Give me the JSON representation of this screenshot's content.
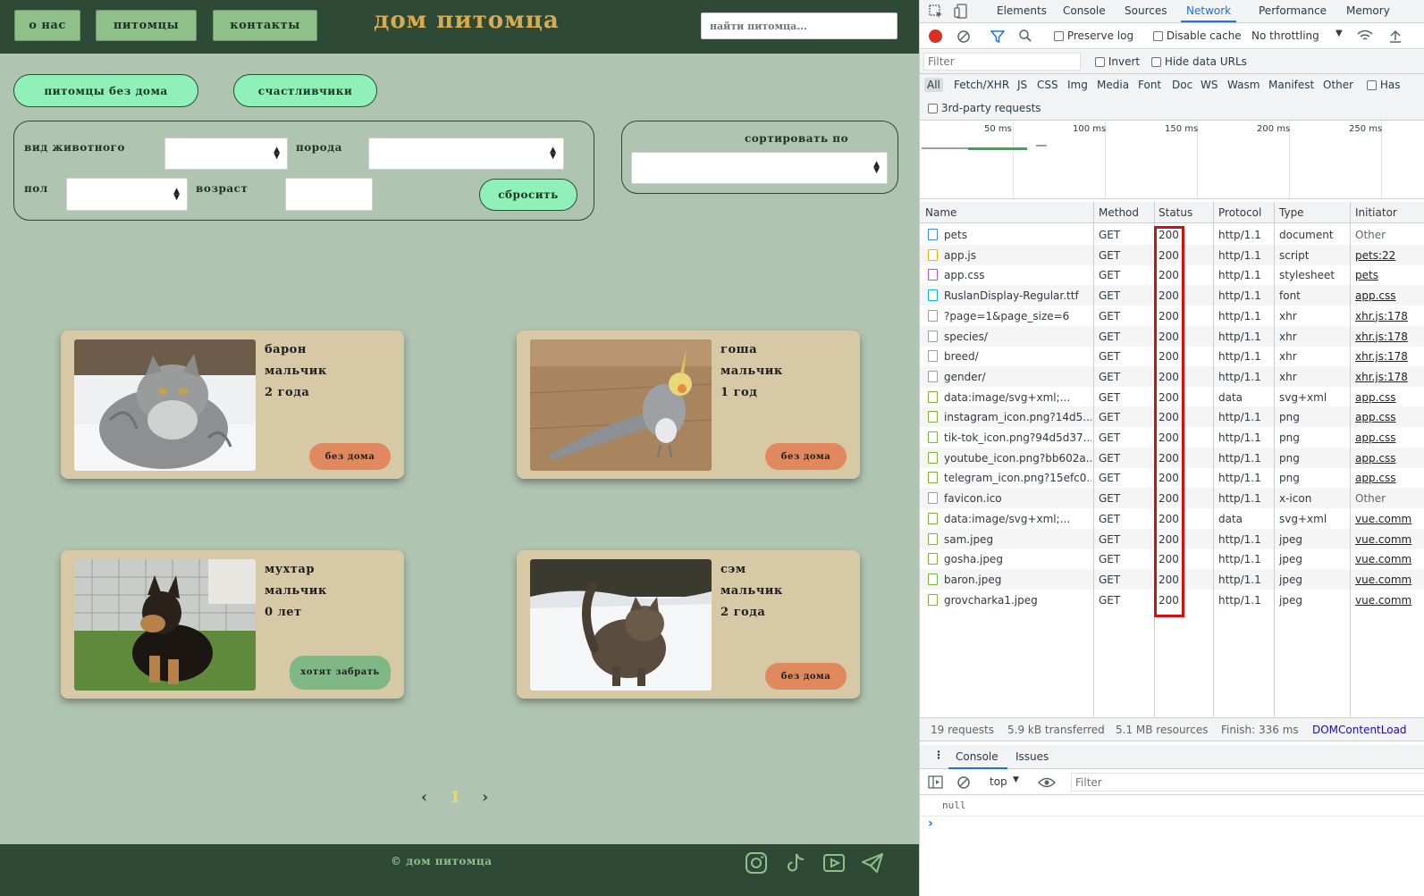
{
  "site": {
    "nav": {
      "about": "о нас",
      "pets": "питомцы",
      "contacts": "контакты"
    },
    "logo": "дом питомца",
    "search_placeholder": "найти питомца...",
    "tabs": {
      "homeless": "питомцы без дома",
      "lucky": "счастливчики"
    },
    "filters": {
      "species_label": "вид животного",
      "breed_label": "порода",
      "gender_label": "пол",
      "age_label": "возраст",
      "reset_label": "сбросить",
      "sort_label": "сортировать по"
    },
    "cards": [
      {
        "name": "барон",
        "gender": "мальчик",
        "age": "2 года",
        "status": "без дома",
        "status_kind": "homeless",
        "photo": "gray-cat"
      },
      {
        "name": "гоша",
        "gender": "мальчик",
        "age": "1 год",
        "status": "без дома",
        "status_kind": "homeless",
        "photo": "cockatiel"
      },
      {
        "name": "мухтар",
        "gender": "мальчик",
        "age": "0 лет",
        "status": "хотят забрать",
        "status_kind": "pending",
        "photo": "shepherd-puppy"
      },
      {
        "name": "сэм",
        "gender": "мальчик",
        "age": "2 года",
        "status": "без дома",
        "status_kind": "homeless",
        "photo": "tabby-cat-snow"
      }
    ],
    "pager": {
      "prev": "‹",
      "current": "1",
      "next": "›"
    },
    "footer": {
      "copyright": "© дом питомца"
    },
    "social_icons": [
      "instagram-icon",
      "tiktok-icon",
      "youtube-icon",
      "telegram-icon"
    ],
    "colors": {
      "header": "#2e4a37",
      "page_bg": "#b0c4b2",
      "logo": "#d7ab4f",
      "pill": "#8ff1b8",
      "card": "#d7c9a6",
      "homeless": "#e0895e",
      "pending": "#7fb885"
    }
  },
  "devtools": {
    "tabs": [
      "Elements",
      "Console",
      "Sources",
      "Network",
      "Performance",
      "Memory"
    ],
    "active_tab": "Network",
    "toolbar": {
      "preserve_log": "Preserve log",
      "disable_cache": "Disable cache",
      "throttling": "No throttling"
    },
    "filter_placeholder": "Filter",
    "invert": "Invert",
    "hide_data_urls": "Hide data URLs",
    "type_filters": [
      "All",
      "Fetch/XHR",
      "JS",
      "CSS",
      "Img",
      "Media",
      "Font",
      "Doc",
      "WS",
      "Wasm",
      "Manifest",
      "Other"
    ],
    "has_label": "Has",
    "third_party": "3rd-party requests",
    "timeline_ticks": [
      "50 ms",
      "100 ms",
      "150 ms",
      "200 ms",
      "250 ms"
    ],
    "columns": [
      "Name",
      "Method",
      "Status",
      "Protocol",
      "Type",
      "Initiator"
    ],
    "requests": [
      {
        "name": "pets",
        "method": "GET",
        "status": "200",
        "protocol": "http/1.1",
        "type": "document",
        "initiator": "Other",
        "icon": "document-icon"
      },
      {
        "name": "app.js",
        "method": "GET",
        "status": "200",
        "protocol": "http/1.1",
        "type": "script",
        "initiator": "pets:22",
        "icon": "script-icon"
      },
      {
        "name": "app.css",
        "method": "GET",
        "status": "200",
        "protocol": "http/1.1",
        "type": "stylesheet",
        "initiator": "pets",
        "icon": "stylesheet-icon"
      },
      {
        "name": "RuslanDisplay-Regular.ttf",
        "method": "GET",
        "status": "200",
        "protocol": "http/1.1",
        "type": "font",
        "initiator": "app.css",
        "icon": "font-icon"
      },
      {
        "name": "?page=1&page_size=6",
        "method": "GET",
        "status": "200",
        "protocol": "http/1.1",
        "type": "xhr",
        "initiator": "xhr.js:178",
        "icon": "xhr-icon"
      },
      {
        "name": "species/",
        "method": "GET",
        "status": "200",
        "protocol": "http/1.1",
        "type": "xhr",
        "initiator": "xhr.js:178",
        "icon": "xhr-icon"
      },
      {
        "name": "breed/",
        "method": "GET",
        "status": "200",
        "protocol": "http/1.1",
        "type": "xhr",
        "initiator": "xhr.js:178",
        "icon": "xhr-icon"
      },
      {
        "name": "gender/",
        "method": "GET",
        "status": "200",
        "protocol": "http/1.1",
        "type": "xhr",
        "initiator": "xhr.js:178",
        "icon": "xhr-icon"
      },
      {
        "name": "data:image/svg+xml;...",
        "method": "GET",
        "status": "200",
        "protocol": "data",
        "type": "svg+xml",
        "initiator": "app.css",
        "icon": "image-icon"
      },
      {
        "name": "instagram_icon.png?14d5...",
        "method": "GET",
        "status": "200",
        "protocol": "http/1.1",
        "type": "png",
        "initiator": "app.css",
        "icon": "image-icon"
      },
      {
        "name": "tik-tok_icon.png?94d5d37...",
        "method": "GET",
        "status": "200",
        "protocol": "http/1.1",
        "type": "png",
        "initiator": "app.css",
        "icon": "image-icon"
      },
      {
        "name": "youtube_icon.png?bb602a...",
        "method": "GET",
        "status": "200",
        "protocol": "http/1.1",
        "type": "png",
        "initiator": "app.css",
        "icon": "image-icon"
      },
      {
        "name": "telegram_icon.png?15efc0...",
        "method": "GET",
        "status": "200",
        "protocol": "http/1.1",
        "type": "png",
        "initiator": "app.css",
        "icon": "image-icon"
      },
      {
        "name": "favicon.ico",
        "method": "GET",
        "status": "200",
        "protocol": "http/1.1",
        "type": "x-icon",
        "initiator": "Other",
        "icon": "xhr-icon"
      },
      {
        "name": "data:image/svg+xml;...",
        "method": "GET",
        "status": "200",
        "protocol": "data",
        "type": "svg+xml",
        "initiator": "vue.comm",
        "icon": "image-icon"
      },
      {
        "name": "sam.jpeg",
        "method": "GET",
        "status": "200",
        "protocol": "http/1.1",
        "type": "jpeg",
        "initiator": "vue.comm",
        "icon": "image-icon"
      },
      {
        "name": "gosha.jpeg",
        "method": "GET",
        "status": "200",
        "protocol": "http/1.1",
        "type": "jpeg",
        "initiator": "vue.comm",
        "icon": "image-icon"
      },
      {
        "name": "baron.jpeg",
        "method": "GET",
        "status": "200",
        "protocol": "http/1.1",
        "type": "jpeg",
        "initiator": "vue.comm",
        "icon": "image-icon"
      },
      {
        "name": "grovcharka1.jpeg",
        "method": "GET",
        "status": "200",
        "protocol": "http/1.1",
        "type": "jpeg",
        "initiator": "vue.comm",
        "icon": "image-icon"
      }
    ],
    "summary": {
      "requests": "19 requests",
      "transferred": "5.9 kB transferred",
      "resources": "5.1 MB resources",
      "finish": "Finish: 336 ms",
      "dcl": "DOMContentLoad"
    },
    "drawer_tabs": [
      "Console",
      "Issues"
    ],
    "console": {
      "context": "top",
      "filter_placeholder": "Filter",
      "output": "null",
      "prompt": "›"
    },
    "colors": {
      "accent": "#1a73e8",
      "highlight_box": "#d30f0f"
    }
  }
}
